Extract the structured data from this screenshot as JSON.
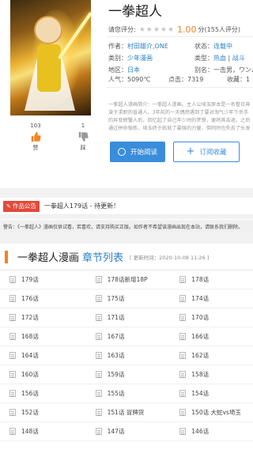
{
  "comic": {
    "title": "一拳超人",
    "rating_label": "请您评分:",
    "stars": "★★★★★",
    "score": "1.00",
    "rating_count": "分(155人评分)",
    "author_label": "作者：",
    "author": "村田雄介,ONE",
    "status_label": "状态：",
    "status": "连载中",
    "category_label": "类别：",
    "category": "少年漫画",
    "type_label": "类型：",
    "type": "热血",
    "type_sep": " | ",
    "type2": "战斗",
    "region_label": "地区：",
    "region": "日本",
    "alias_label": "别名：",
    "alias": "一击男，ワンパ",
    "popularity_label": "人气：",
    "popularity": "5090℃",
    "clicks_label": "点击：",
    "clicks": "7319",
    "favorites_label": "收藏：",
    "favorites": "1",
    "intro": "一拳超人漫画简介：一拳超人漫画。主人公埼玉原本是一名整日奔波于求职的普通人。3年前的一天偶然遇到了要对淘气少年下杀手的异变螃蟹人后，回忆起了自己年少时的梦想，便将其击退。之后通过拼命锻炼，埼玉终于练就了最强的力量，但同时也失去了头发变成了秃头。在某个时期，埼玉注意到，正式加入英雄协会，与众多英雄一起开始了对抗各种怪人的"
  },
  "votes": {
    "up_count": "103",
    "up_label": "赞",
    "down_count": "1",
    "down_label": "踩"
  },
  "buttons": {
    "read": "开始阅读",
    "subscribe": "订阅收藏"
  },
  "notice": {
    "tag": "作品公告",
    "text": "一拳超人179话 - 待更新！"
  },
  "warning": "警告：《一拳超人》漫画仅供试看，若喜欢，请支持购买正版。如作者不希望该漫画出现在本站，请联系我们删除。",
  "chapters": {
    "title": "一拳超人漫画",
    "list_label": "章节列表",
    "updated": "[ 更新时间：2020-10-08 11:26 ]",
    "items": [
      [
        "179话",
        "178话新增18P",
        "178话"
      ],
      [
        "176话",
        "175话",
        "174话"
      ],
      [
        "172话",
        "171话",
        "170话"
      ],
      [
        "168话",
        "167话",
        "166话"
      ],
      [
        "164话",
        "163话",
        "162话"
      ],
      [
        "160话",
        "159话",
        "158话"
      ],
      [
        "156话",
        "155话",
        "154话"
      ],
      [
        "152话",
        "151话 冒牌货",
        "150话 大蛇vs埼玉"
      ],
      [
        "148话",
        "147话",
        "146话"
      ]
    ]
  },
  "colors": {
    "accent_blue": "#3a8ddb",
    "accent_orange": "#f58220",
    "notice_red": "#e24a3b"
  }
}
